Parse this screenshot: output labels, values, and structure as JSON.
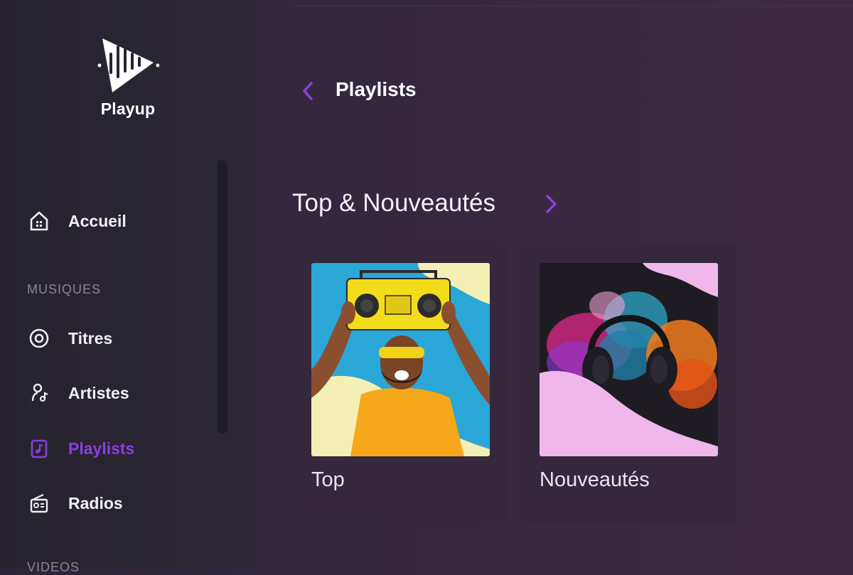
{
  "app": {
    "name": "Playup"
  },
  "sidebar": {
    "items": [
      {
        "label": "Accueil",
        "icon": "home-icon"
      },
      {
        "label": "Titres",
        "icon": "disc-icon"
      },
      {
        "label": "Artistes",
        "icon": "artist-icon"
      },
      {
        "label": "Playlists",
        "icon": "playlist-icon",
        "active": true
      },
      {
        "label": "Radios",
        "icon": "radio-icon"
      }
    ],
    "sections": [
      {
        "label": "MUSIQUES"
      },
      {
        "label": "VIDEOS"
      }
    ]
  },
  "header": {
    "title": "Playlists",
    "back_icon": "chevron-left-icon"
  },
  "main": {
    "section_title": "Top & Nouveautés",
    "section_arrow_icon": "chevron-right-icon",
    "cards": [
      {
        "caption": "Top"
      },
      {
        "caption": "Nouveautés"
      }
    ]
  },
  "colors": {
    "accent": "#8b3fe0",
    "background": "#33283d",
    "sidebar": "#27242f",
    "card": "#35283d"
  }
}
